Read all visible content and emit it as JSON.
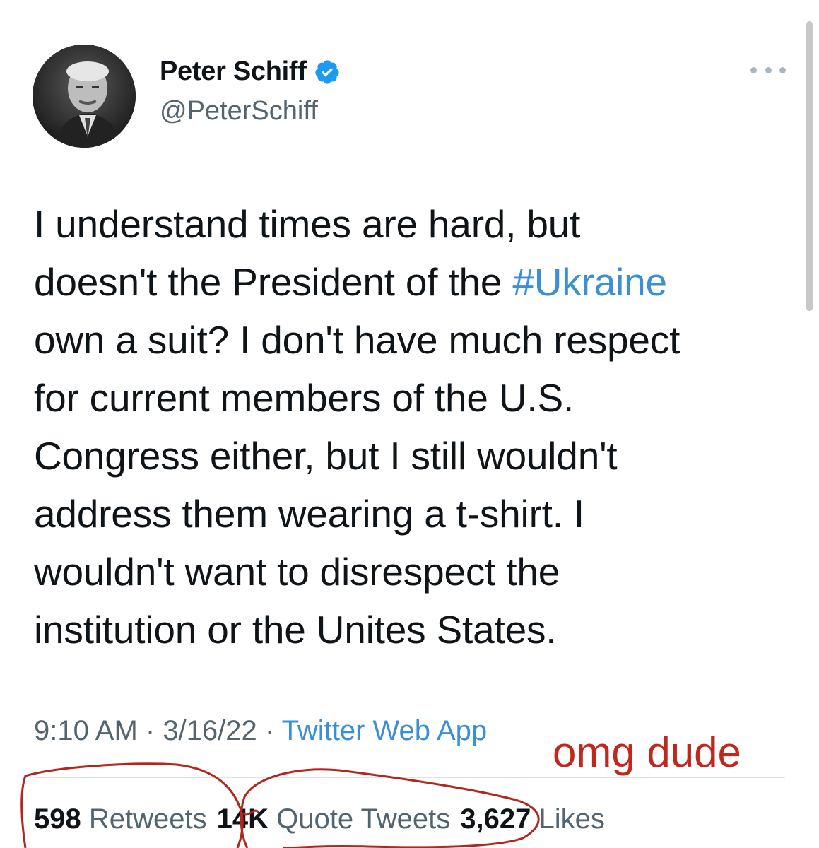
{
  "author": {
    "display_name": "Peter Schiff",
    "handle": "@PeterSchiff",
    "verified": true,
    "avatar_icon": "avatar-photo"
  },
  "tweet": {
    "lines": [
      {
        "text": "I understand times are hard, but"
      },
      {
        "text": "doesn't the President of the ",
        "hashtag": "#Ukraine"
      },
      {
        "text": "own a suit? I don't have much respect"
      },
      {
        "text": "for current members of the U.S."
      },
      {
        "text": "Congress either, but I still wouldn't"
      },
      {
        "text": "address them wearing a t-shirt. I"
      },
      {
        "text": "wouldn't want to disrespect the"
      },
      {
        "text": "institution or the Unites States."
      }
    ]
  },
  "meta": {
    "time": "9:10 AM",
    "separator": " · ",
    "date": "3/16/22",
    "source": "Twitter Web App"
  },
  "stats": {
    "retweets_count": "598",
    "retweets_label": "Retweets",
    "quote_count": "14K",
    "quote_label": "Quote Tweets",
    "likes_count": "3,627",
    "likes_label": "Likes"
  },
  "annotation": {
    "text": "omg dude",
    "color": "#c0281e"
  },
  "colors": {
    "link": "#3a8fd6",
    "verified": "#1d9bf0",
    "secondary_text": "#536471",
    "primary_text": "#0f1419"
  },
  "icons": {
    "verified": "verified-badge-icon",
    "more": "more-options-icon"
  }
}
